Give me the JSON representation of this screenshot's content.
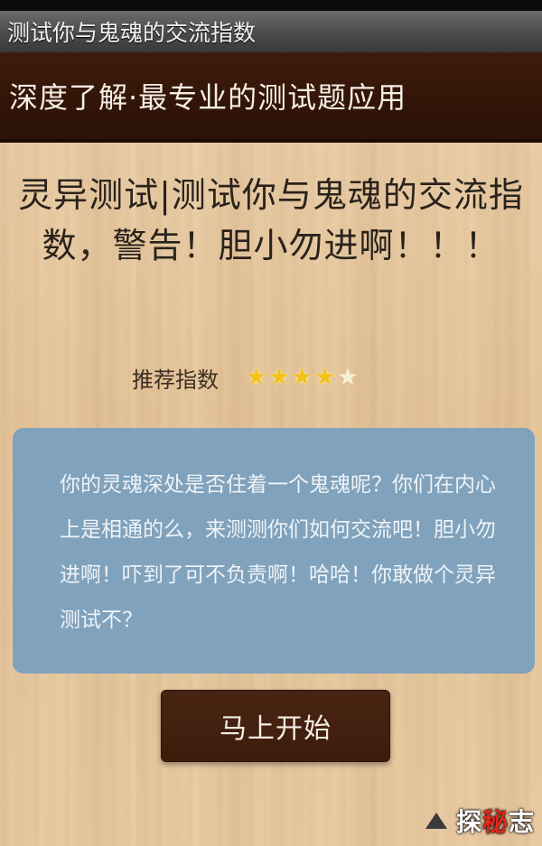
{
  "window": {
    "title": "测试你与鬼魂的交流指数"
  },
  "banner": {
    "text": "深度了解·最专业的测试题应用"
  },
  "headline": {
    "text": "灵异测试|测试你与鬼魂的交流指数，警告！胆小勿进啊！！！"
  },
  "rating": {
    "label": "推荐指数",
    "value": 4,
    "max": 5
  },
  "description": {
    "text": "你的灵魂深处是否住着一个鬼魂呢？你们在内心上是相通的么，来测测你们如何交流吧！胆小勿进啊！吓到了可不负责啊！哈哈！你敢做个灵异测试不？"
  },
  "start_button": {
    "label": "马上开始"
  },
  "watermark": {
    "part1": "探",
    "part2": "秘",
    "part3": "志"
  },
  "colors": {
    "banner_bg": "#321507",
    "card_bg": "#769ec0",
    "button_bg": "#3d1c0c",
    "star_active": "#f2c21b",
    "watermark_accent": "#e0261c"
  }
}
